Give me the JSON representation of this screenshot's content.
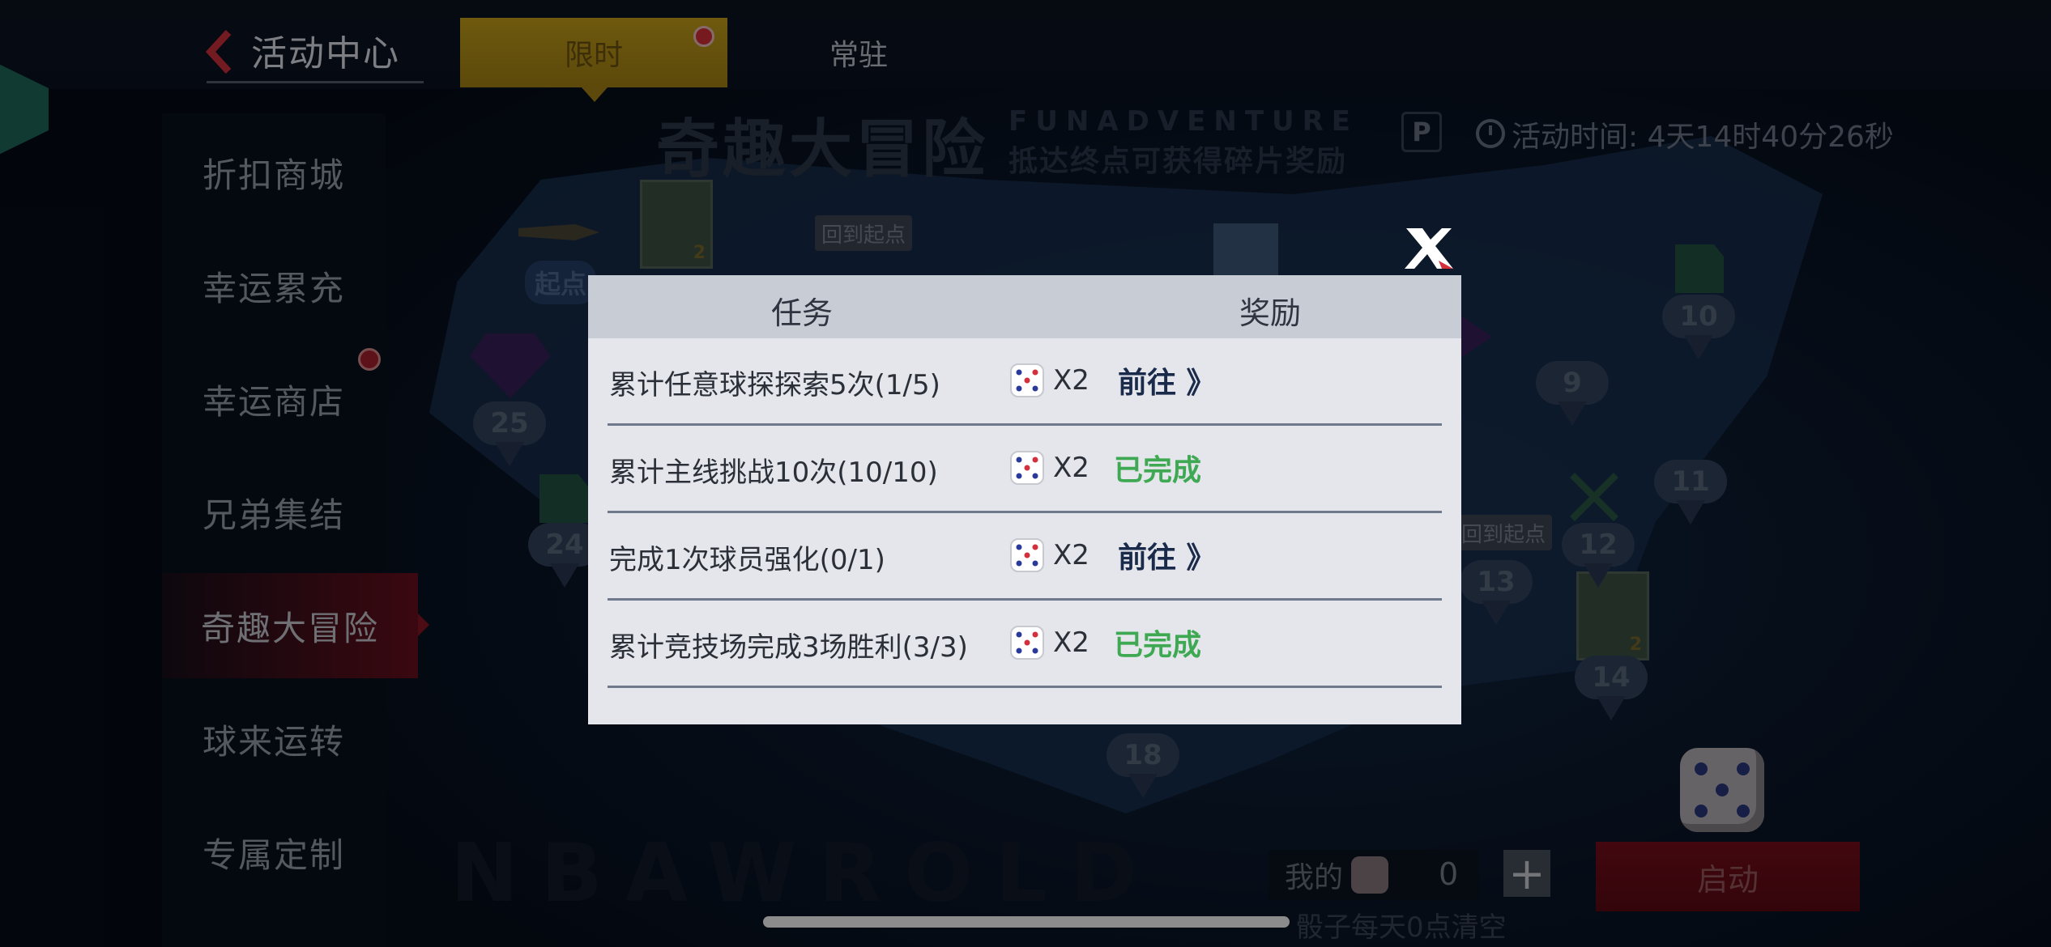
{
  "header": {
    "title": "活动中心",
    "tabs": [
      {
        "label": "限时",
        "active": true,
        "has_dot": true
      },
      {
        "label": "常驻",
        "active": false,
        "has_dot": false
      }
    ]
  },
  "sidebar": {
    "items": [
      {
        "label": "折扣商城",
        "active": false
      },
      {
        "label": "幸运累充",
        "active": false
      },
      {
        "label": "幸运商店",
        "active": false,
        "has_dot": true
      },
      {
        "label": "兄弟集结",
        "active": false
      },
      {
        "label": "奇趣大冒险",
        "active": true
      },
      {
        "label": "球来运转",
        "active": false
      },
      {
        "label": "专属定制",
        "active": false
      }
    ]
  },
  "banner": {
    "title": "奇趣大冒险",
    "english": "FUNADVENTURE",
    "subtitle": "抵达终点可获得碎片奖励",
    "p_label": "P",
    "activity_time": "活动时间: 4天14时40分26秒"
  },
  "map": {
    "start_label": "起点",
    "back_to_start_tags": [
      "回到起点",
      "回到起点"
    ],
    "nodes": [
      "25",
      "24",
      "10",
      "9",
      "11",
      "12",
      "13",
      "14",
      "18"
    ],
    "watermark": "NBAWROLD"
  },
  "footer": {
    "my_dice_label": "我的",
    "dice_count": "0",
    "plus_label": "+",
    "reset_note": "骰子每天0点清空",
    "launch_label": "启动"
  },
  "modal": {
    "col_task": "任务",
    "col_reward": "奖励",
    "tasks": [
      {
        "name": "累计任意球探探索5次(1/5)",
        "reward": "X2",
        "action": "前往 》",
        "status": "go"
      },
      {
        "name": "累计主线挑战10次(10/10)",
        "reward": "X2",
        "action": "已完成",
        "status": "done"
      },
      {
        "name": "完成1次球员强化(0/1)",
        "reward": "X2",
        "action": "前往 》",
        "status": "go"
      },
      {
        "name": "累计竞技场完成3场胜利(3/3)",
        "reward": "X2",
        "action": "已完成",
        "status": "done"
      }
    ]
  },
  "colors": {
    "accent_red": "#d8303a",
    "tab_gold": "#caa31c",
    "done_green": "#3ea852",
    "go_navy": "#1a2a4a"
  }
}
